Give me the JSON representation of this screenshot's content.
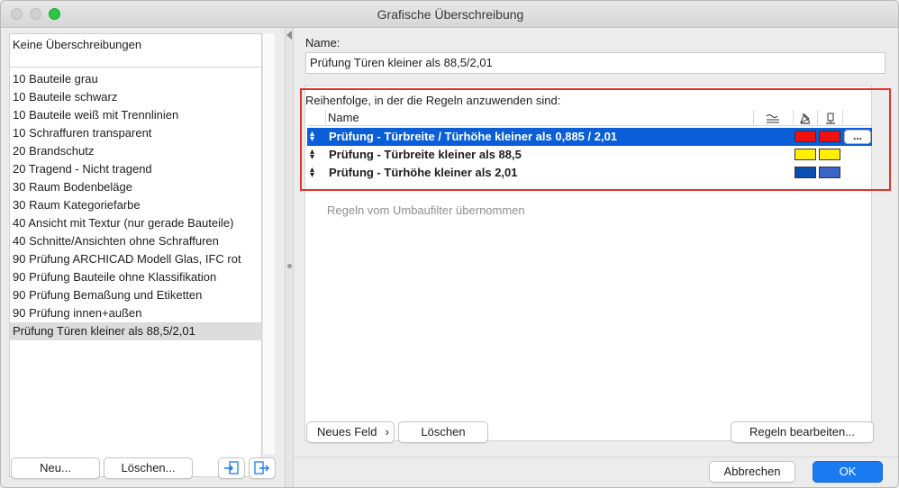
{
  "window": {
    "title": "Grafische Überschreibung"
  },
  "sidebar": {
    "items": [
      {
        "label": "Keine Überschreibungen"
      },
      {
        "label": "10 Bauteile grau"
      },
      {
        "label": "10 Bauteile schwarz"
      },
      {
        "label": "10 Bauteile weiß mit Trennlinien"
      },
      {
        "label": "10 Schraffuren transparent"
      },
      {
        "label": "20 Brandschutz"
      },
      {
        "label": "20 Tragend - Nicht tragend"
      },
      {
        "label": "30 Raum Bodenbeläge"
      },
      {
        "label": "30 Raum Kategoriefarbe"
      },
      {
        "label": "40 Ansicht mit Textur (nur gerade Bauteile)"
      },
      {
        "label": "40 Schnitte/Ansichten ohne Schraffuren"
      },
      {
        "label": "90 Prüfung ARCHICAD Modell Glas, IFC rot"
      },
      {
        "label": "90 Prüfung Bauteile ohne Klassifikation"
      },
      {
        "label": "90 Prüfung Bemaßung und Etiketten"
      },
      {
        "label": "90 Prüfung innen+außen"
      },
      {
        "label": "Prüfung Türen kleiner als 88,5/2,01",
        "selected": true
      }
    ],
    "new_button": "Neu...",
    "delete_button": "Löschen...",
    "import_icon": "import-icon",
    "export_icon": "export-icon"
  },
  "detail": {
    "name_label": "Name:",
    "name_value": "Prüfung Türen kleiner als 88,5/2,01",
    "order_label": "Reihenfolge, in der die Regeln anzuwenden sind:",
    "column_name": "Name",
    "column_icons": [
      "fill-pattern-icon",
      "fill-foreground-icon",
      "fill-background-icon"
    ],
    "rules": [
      {
        "name": "Prüfung - Türbreite / Türhöhe kleiner als 0,885 / 2,01",
        "fg": "#f01010",
        "bg": "#f01010",
        "selected": true
      },
      {
        "name": "Prüfung - Türbreite kleiner als 88,5",
        "fg": "#ffee00",
        "bg": "#ffee00",
        "selected": false
      },
      {
        "name": "Prüfung - Türhöhe kleiner als 2,01",
        "fg": "#0a4fb0",
        "bg": "#3a64c8",
        "selected": false
      }
    ],
    "rule_more_button": "...",
    "inherited_note": "Regeln vom Umbaufilter übernommen",
    "new_field_button": "Neues Feld",
    "delete_rule_button": "Löschen",
    "edit_rules_button": "Regeln bearbeiten..."
  },
  "footer": {
    "cancel_button": "Abbrechen",
    "ok_button": "OK"
  },
  "colors": {
    "accent": "#1a7bf1",
    "selection": "#0a5fd8",
    "highlight_box": "#e2332b"
  }
}
